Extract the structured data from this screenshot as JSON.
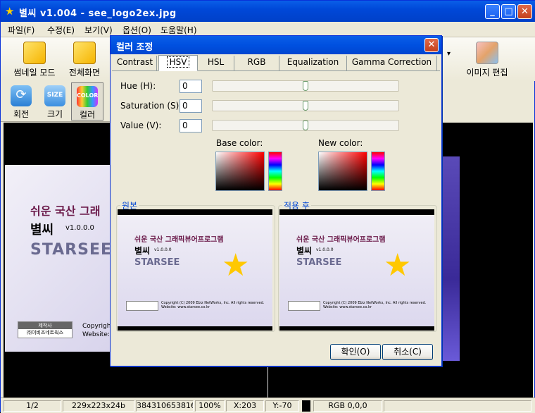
{
  "window": {
    "title": "별씨 v1.004 - see_logo2ex.jpg",
    "min": "_",
    "max": "□",
    "close": "✕"
  },
  "menu": [
    "파일(F)",
    "수정(E)",
    "보기(V)",
    "옵션(O)",
    "도움말(H)"
  ],
  "toolbar": {
    "thumb": "썸네일 모드",
    "full": "전체화면",
    "edit": "이미지 편집",
    "arrow": "▾"
  },
  "toolbar2": {
    "rotate": "회전",
    "size": "크기",
    "color": "컬러",
    "size_icon": "SIZE",
    "color_icon": "COLOR"
  },
  "canvas": {
    "line1": "쉬운 국산 그래",
    "line2": "별씨",
    "version": "v1.0.0.0",
    "brand": "STARSEE",
    "maker_label": "제작사",
    "maker": "㈜이비즈네트웍스",
    "copy1": "Copyrigh",
    "copy2": "Website:"
  },
  "dialog": {
    "title": "컬러 조정",
    "close": "✕",
    "tabs": [
      "Contrast",
      "HSV",
      "HSL",
      "RGB",
      "Equalization",
      "Gamma Correction"
    ],
    "active_tab": "HSV",
    "hue_label": "Hue (H):",
    "hue_value": "0",
    "sat_label": "Saturation (S):",
    "sat_value": "0",
    "val_label": "Value (V):",
    "val_value": "0",
    "base_color": "Base color:",
    "new_color": "New color:",
    "original": "원본",
    "applied": "적용 후",
    "ok": "확인(O)",
    "cancel": "취소(C)",
    "preview": {
      "line1": "쉬운 국산 그래픽뷰어프로그램",
      "line2": "별씨",
      "version": "v1.0.0.0",
      "brand": "STARSEE",
      "copyright": "Copyright (C) 2009 Ebiz NetWorks, Inc. All rights reserved.",
      "website": "Website: www.starsee.co.kr"
    }
  },
  "status": {
    "page": "1/2",
    "dims": "229x223x24b",
    "bytes": "384310653816(",
    "zoom": "100%",
    "x": "X:203",
    "y": "Y:-70",
    "rgb": "RGB 0,0,0"
  },
  "colors": {
    "titlebar": "#0054e3",
    "dialog_close": "#e05a3a",
    "splash_title": "#6b1a4a",
    "brand": "#6a6a90"
  }
}
